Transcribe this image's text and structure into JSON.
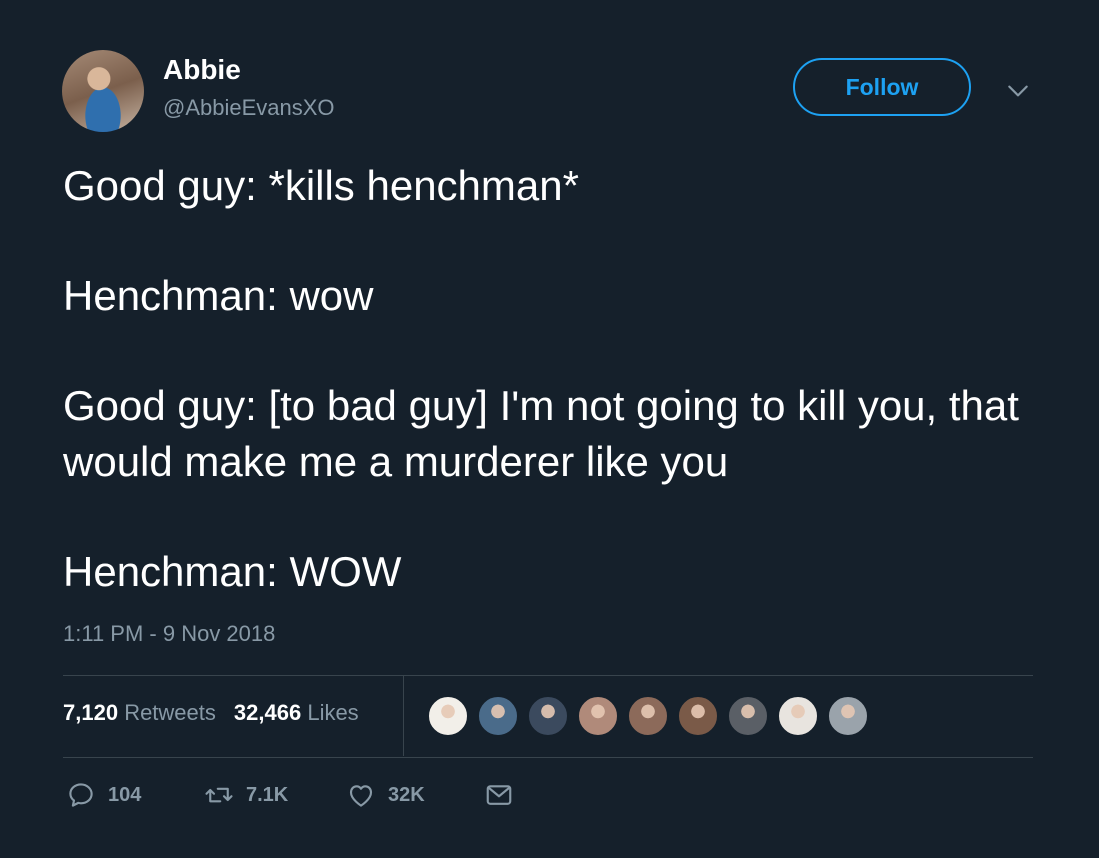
{
  "author": {
    "name": "Abbie",
    "handle": "@AbbieEvansXO"
  },
  "follow_label": "Follow",
  "tweet_lines": {
    "line1": "Good guy: *kills henchman*",
    "line2": "Henchman: wow",
    "line3": "Good guy: [to bad guy] I'm not going to kill you, that would make me a murderer like you",
    "line4": "Henchman: WOW"
  },
  "timestamp": "1:11 PM - 9 Nov 2018",
  "stats": {
    "retweets_count": "7,120",
    "retweets_label": "Retweets",
    "likes_count": "32,466",
    "likes_label": "Likes"
  },
  "liker_colors": [
    "#f2efe9",
    "#4a6b8a",
    "#3b4a5e",
    "#b08a7a",
    "#8c6a5a",
    "#7a5a48",
    "#5a5f66",
    "#e8e4df",
    "#9aa3ab"
  ],
  "actions": {
    "replies": "104",
    "retweets": "7.1K",
    "likes": "32K"
  },
  "colors": {
    "background": "#15202b",
    "accent": "#1da1f2",
    "muted": "#8899a6"
  },
  "icons": {
    "reply": "reply-icon",
    "retweet": "retweet-icon",
    "like": "heart-icon",
    "message": "envelope-icon",
    "chevron": "chevron-down-icon"
  }
}
